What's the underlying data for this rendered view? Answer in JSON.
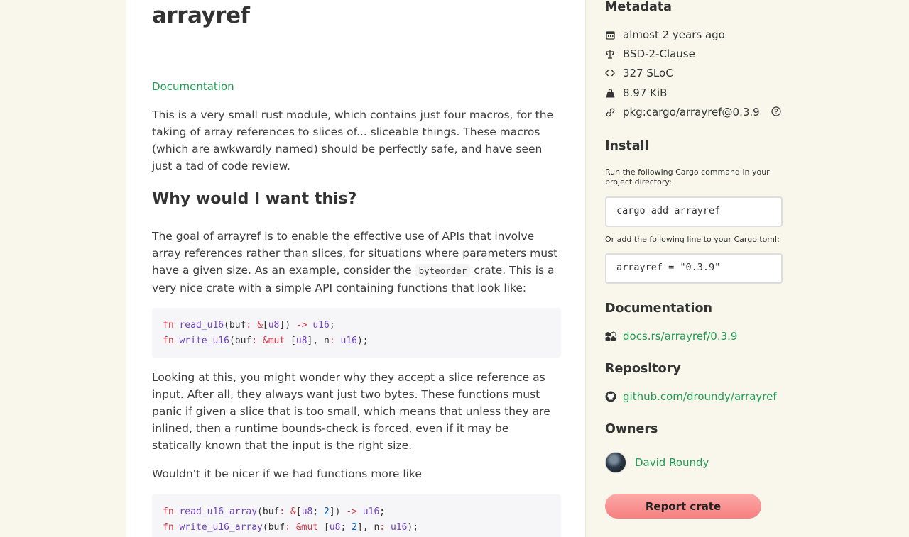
{
  "crate": {
    "title": "arrayref",
    "doc_link": "Documentation"
  },
  "readme": {
    "intro": "This is a very small rust module, which contains just four macros, for the taking of array references to slices of... sliceable things. These macros (which are awkwardly named) should be perfectly safe, and have seen just a tad of code review.",
    "heading": "Why would I want this?",
    "goal_before": "The goal of arrayref is to enable the effective use of APIs that involve array references rather than slices, for situations where parameters must have a given size. As an example, consider the ",
    "goal_code": "byteorder",
    "goal_after": " crate. This is a very nice crate with a simple API containing functions that look like:",
    "code1": [
      {
        "kw": "fn ",
        "name": "read_u16",
        "rest_a": "(buf",
        "colon": ": ",
        "amp": "&",
        "br": "[",
        "ty": "u8",
        "br2": "]) ",
        "arrow": "->",
        "sp": " ",
        "ret": "u16",
        "end": ";"
      },
      {
        "kw": "fn ",
        "name": "write_u16",
        "rest_a": "(buf",
        "colon": ": ",
        "amp": "&mut",
        "br": " [",
        "ty": "u8",
        "br2": "], n",
        "arrow": ":",
        "sp": " ",
        "ret": "u16",
        "end": ");"
      }
    ],
    "looking": "Looking at this, you might wonder why they accept a slice reference as input. After all, they always want just two bytes. These functions must panic if given a slice that is too small, which means that unless they are inlined, then a runtime bounds-check is forced, even if it may be statically known that the input is the right size.",
    "nicer": "Wouldn't it be nicer if we had functions more like",
    "code2": [
      {
        "kw": "fn ",
        "name": "read_u16_array",
        "rest_a": "(buf",
        "colon": ": ",
        "amp": "&",
        "br": "[",
        "ty": "u8",
        "semi": "; ",
        "num": "2",
        "br2": "]) ",
        "arrow": "->",
        "sp": " ",
        "ret": "u16",
        "end": ";"
      },
      {
        "kw": "fn ",
        "name": "write_u16_array",
        "rest_a": "(buf",
        "colon": ": ",
        "amp": "&mut",
        "br": " [",
        "ty": "u8",
        "semi": "; ",
        "num": "2",
        "br2": "], n",
        "arrow": ":",
        "sp": " ",
        "ret": "u16",
        "end": ");"
      }
    ]
  },
  "sidebar": {
    "metadata_heading": "Metadata",
    "metadata": [
      {
        "icon": "calendar-icon",
        "text": "almost 2 years ago"
      },
      {
        "icon": "scale-icon",
        "text": "BSD-2-Clause"
      },
      {
        "icon": "code-icon",
        "text": "327 SLoC"
      },
      {
        "icon": "weight-icon",
        "text": "8.97 KiB"
      },
      {
        "icon": "link-icon",
        "text": "pkg:cargo/arrayref@0.3.9"
      }
    ],
    "install_heading": "Install",
    "install_note1": "Run the following Cargo command in your project directory:",
    "install_cmd": "cargo add arrayref",
    "install_note2": "Or add the following line to your Cargo.toml:",
    "install_toml": "arrayref = \"0.3.9\"",
    "documentation_heading": "Documentation",
    "docs_link": "docs.rs/arrayref/0.3.9",
    "repository_heading": "Repository",
    "repo_link": "github.com/droundy/arrayref",
    "owners_heading": "Owners",
    "owner_name": "David Roundy",
    "report_label": "Report crate"
  },
  "colors": {
    "link": "#1f9d55",
    "page_bg": "#f9f7ec",
    "report_button": "#f67f7f"
  }
}
